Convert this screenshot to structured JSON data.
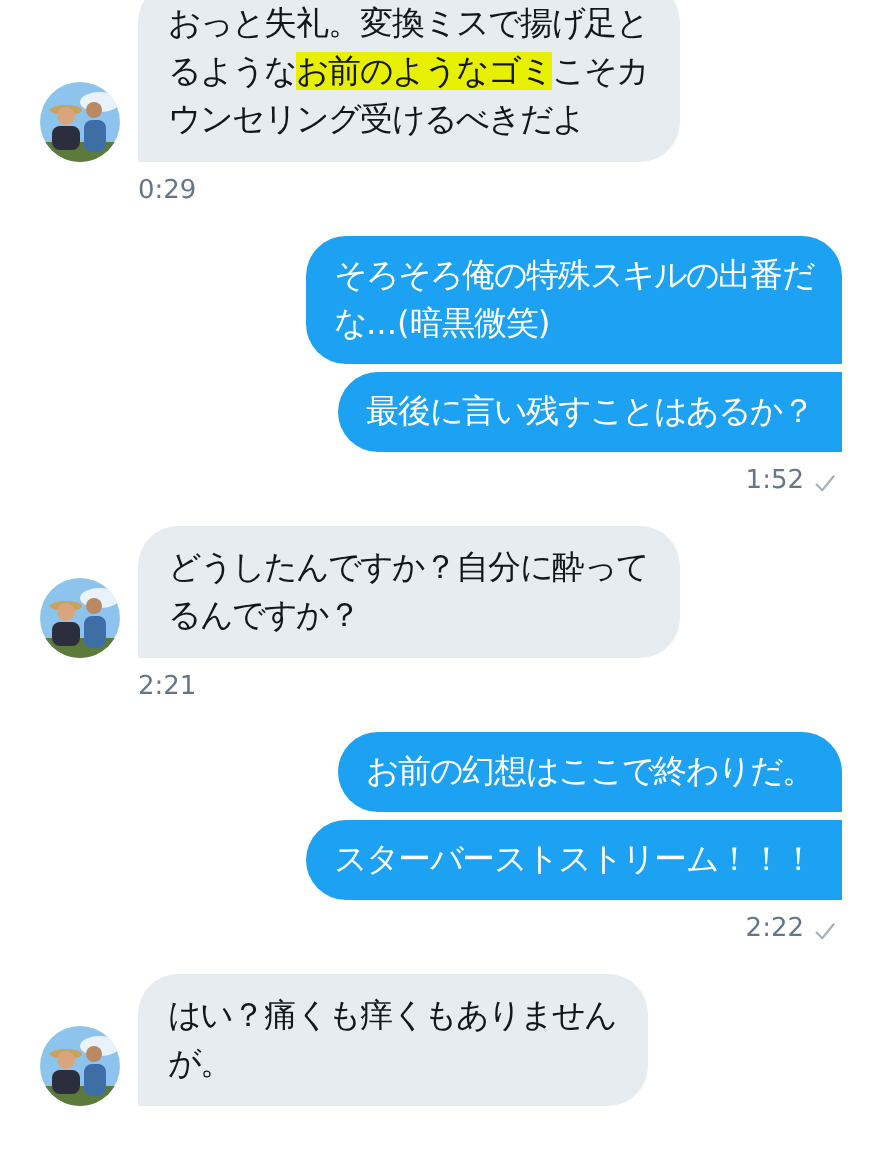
{
  "messages": [
    {
      "kind": "incoming",
      "bubbles": [
        {
          "lines": [
            [
              {
                "text": "おっと失礼。変換ミスで揚げ足と",
                "highlighted": false
              }
            ],
            [
              {
                "text": "るような",
                "highlighted": false
              },
              {
                "text": "お前のようなゴミ",
                "highlighted": true
              },
              {
                "text": "こそカ",
                "highlighted": false
              }
            ],
            [
              {
                "text": "ウンセリング受けるべきだよ",
                "highlighted": false
              }
            ]
          ]
        }
      ],
      "time": "0:29"
    },
    {
      "kind": "outgoing",
      "bubbles": [
        {
          "lines": [
            [
              {
                "text": "そろそろ俺の特殊スキルの出番だ",
                "highlighted": false
              }
            ],
            [
              {
                "text": "な...(暗黒微笑)",
                "highlighted": false
              }
            ]
          ]
        },
        {
          "lines": [
            [
              {
                "text": "最後に言い残すことはあるか？",
                "highlighted": false
              }
            ]
          ]
        }
      ],
      "time": "1:52",
      "delivered": true
    },
    {
      "kind": "incoming",
      "bubbles": [
        {
          "lines": [
            [
              {
                "text": "どうしたんですか？自分に酔って",
                "highlighted": false
              }
            ],
            [
              {
                "text": "るんですか？",
                "highlighted": false
              }
            ]
          ]
        }
      ],
      "time": "2:21"
    },
    {
      "kind": "outgoing",
      "bubbles": [
        {
          "lines": [
            [
              {
                "text": "お前の幻想はここで終わりだ。",
                "highlighted": false
              }
            ]
          ]
        },
        {
          "lines": [
            [
              {
                "text": "スターバーストストリーム！！！",
                "highlighted": false
              }
            ]
          ]
        }
      ],
      "time": "2:22",
      "delivered": true
    },
    {
      "kind": "incoming",
      "bubbles": [
        {
          "lines": [
            [
              {
                "text": "はい？痛くも痒くもありません",
                "highlighted": false
              }
            ],
            [
              {
                "text": "が。",
                "highlighted": false
              }
            ]
          ]
        }
      ]
    }
  ]
}
